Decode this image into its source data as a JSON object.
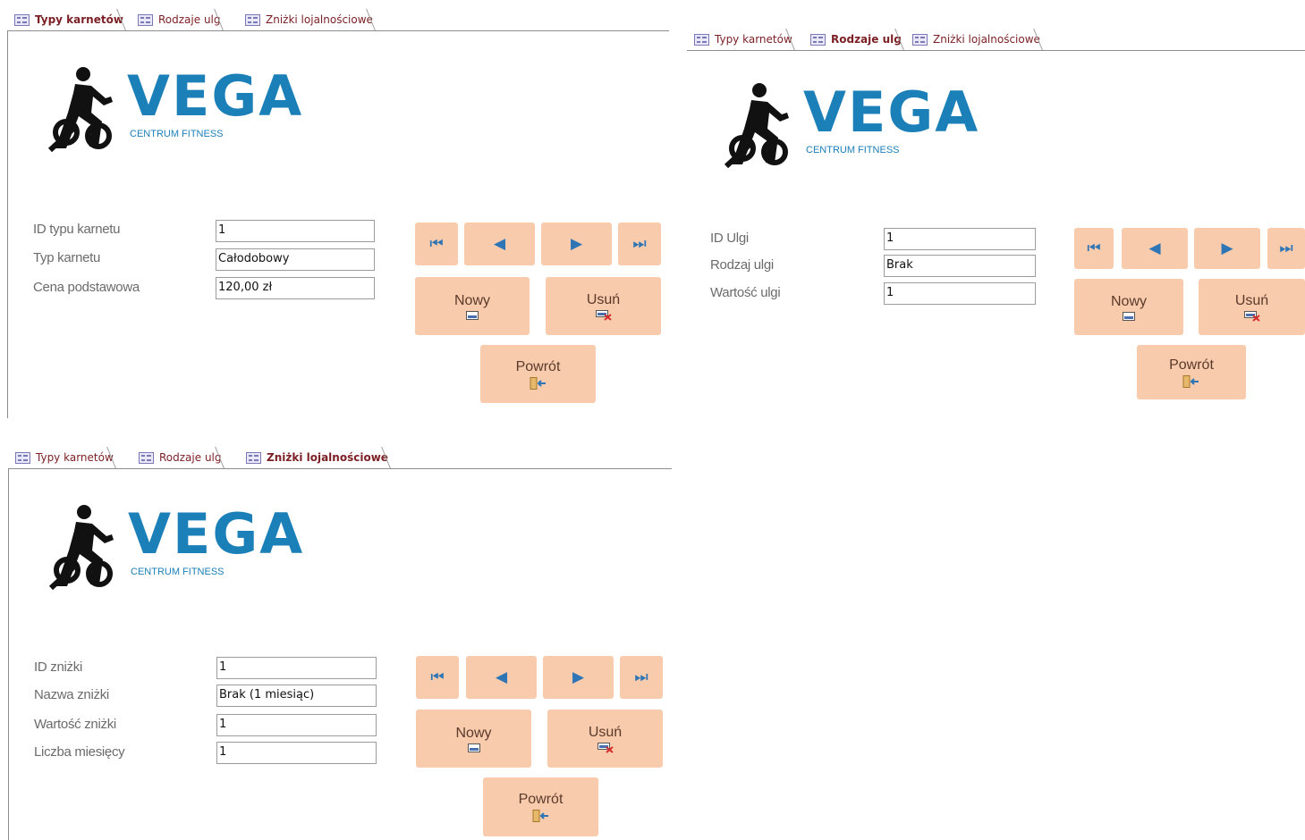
{
  "tabs": [
    "Typy karnetów",
    "Rodzaje ulg",
    "Zniżki lojalnościowe"
  ],
  "logo": {
    "name": "VEGA",
    "subtitle": "CENTRUM FITNESS"
  },
  "buttons": {
    "new": "Nowy",
    "delete": "Usuń",
    "back": "Powrót"
  },
  "nav_icons": [
    "first-record-icon",
    "previous-record-icon",
    "next-record-icon",
    "last-record-icon"
  ],
  "colors": {
    "button_bg": "#f8cbad",
    "tab_text": "#7b1f24",
    "brand": "#1b7fb8",
    "nav_icon": "#2e75b6"
  },
  "forms": {
    "typy": {
      "active_tab": "Typy karnetów",
      "fields": [
        {
          "label": "ID typu karnetu",
          "value": "1"
        },
        {
          "label": "Typ karnetu",
          "value": "Całodobowy"
        },
        {
          "label": "Cena podstawowa",
          "value": "120,00 zł"
        }
      ]
    },
    "ulgi": {
      "active_tab": "Rodzaje ulg",
      "fields": [
        {
          "label": "ID Ulgi",
          "value": "1"
        },
        {
          "label": "Rodzaj ulgi",
          "value": "Brak"
        },
        {
          "label": "Wartość ulgi",
          "value": "1"
        }
      ]
    },
    "znizki": {
      "active_tab": "Zniżki lojalnościowe",
      "fields": [
        {
          "label": "ID zniżki",
          "value": "1"
        },
        {
          "label": "Nazwa zniżki",
          "value": "Brak (1 miesiąc)"
        },
        {
          "label": "Wartość zniżki",
          "value": "1"
        },
        {
          "label": "Liczba miesięcy",
          "value": "1"
        }
      ]
    }
  }
}
